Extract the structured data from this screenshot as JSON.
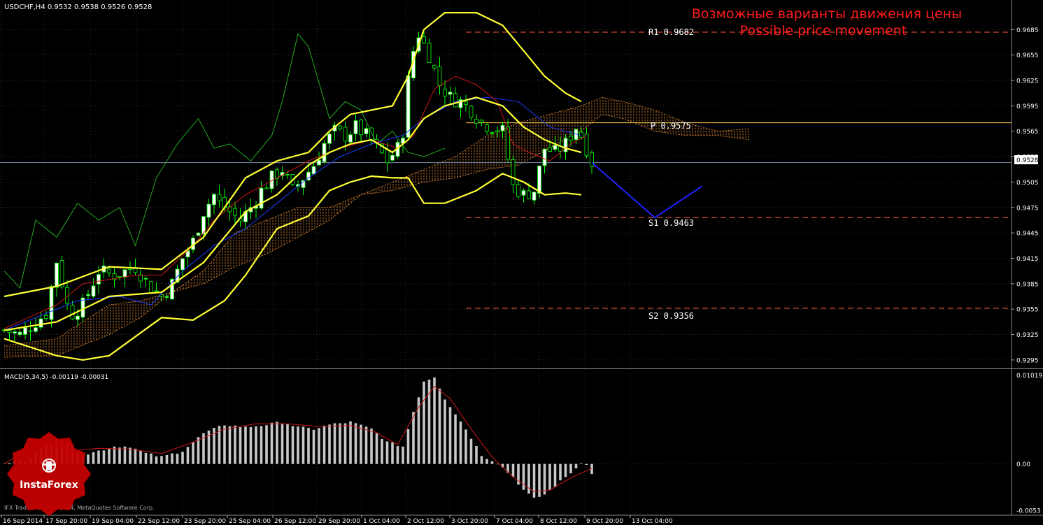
{
  "header": {
    "symbol_info": "USDCHF,H4  0.9532 0.9538 0.9526 0.9528"
  },
  "annotation": {
    "title_ru": "Возможные варианты движения цены",
    "title_en": "Possible price movement"
  },
  "levels": {
    "R1": {
      "label": "R1  0.9682",
      "value": 0.9682
    },
    "P": {
      "label": "P  0.9575",
      "value": 0.9575
    },
    "S1": {
      "label": "S1  0.9463",
      "value": 0.9463
    },
    "S2": {
      "label": "S2  0.9356",
      "value": 0.9356
    }
  },
  "current_price": {
    "label": "0.9528",
    "value": 0.9528
  },
  "macd_label": "MACD(5,34,5) -0.00119 -0.00031",
  "copyright": "IFX Trader, © 2001-2014, MetaQuotes Software Corp.",
  "logo_text": "InstaForex",
  "colors": {
    "background": "#000000",
    "grid": "#4a4a4a",
    "bull_candle": "#ffffff",
    "bear_candle": "#000000",
    "candle_wick": "#00ff00",
    "bollinger": "#ffff33",
    "tenkan": "#cc1818",
    "kijun": "#1a3cff",
    "chikou": "#22aa22",
    "kumo": "#ff9a3a",
    "pivot": "#ffd24a",
    "support_resistance": "#ff5a3a",
    "projection": "#2222ff",
    "macd_hist": "#c8c8c8",
    "macd_signal": "#cc1818",
    "annotation": "#ff1a1a",
    "logo": "#c40000"
  },
  "chart_data": [
    {
      "type": "candlestick",
      "title": "USDCHF,H4",
      "y_ticks": [
        "0.9685",
        "0.9655",
        "0.9625",
        "0.9595",
        "0.9565",
        "0.9535",
        "0.9505",
        "0.9475",
        "0.9445",
        "0.9415",
        "0.9385",
        "0.9355",
        "0.9325",
        "0.9295"
      ],
      "ylim": [
        0.9285,
        0.9715
      ],
      "x_ticks": [
        "16 Sep 2014",
        "17 Sep 20:00",
        "19 Sep 04:00",
        "22 Sep 12:00",
        "23 Sep 20:00",
        "25 Sep 04:00",
        "26 Sep 12:00",
        "29 Sep 20:00",
        "1 Oct 04:00",
        "2 Oct 12:00",
        "3 Oct 20:00",
        "7 Oct 04:00",
        "8 Oct 12:00",
        "9 Oct 20:00",
        "13 Oct 04:00"
      ],
      "bars_total": 171,
      "candles_range": [
        0,
        112
      ],
      "candle_path_close": [
        [
          0,
          0.933
        ],
        [
          3,
          0.9325
        ],
        [
          6,
          0.934
        ],
        [
          8,
          0.935
        ],
        [
          10,
          0.9412
        ],
        [
          12,
          0.936
        ],
        [
          13,
          0.935
        ],
        [
          15,
          0.936
        ],
        [
          18,
          0.94
        ],
        [
          21,
          0.9395
        ],
        [
          23,
          0.94
        ],
        [
          25,
          0.9405
        ],
        [
          28,
          0.938
        ],
        [
          30,
          0.937
        ],
        [
          32,
          0.9385
        ],
        [
          34,
          0.9415
        ],
        [
          36,
          0.9435
        ],
        [
          38,
          0.947
        ],
        [
          40,
          0.949
        ],
        [
          41,
          0.948
        ],
        [
          43,
          0.947
        ],
        [
          45,
          0.946
        ],
        [
          47,
          0.9475
        ],
        [
          49,
          0.9495
        ],
        [
          51,
          0.951
        ],
        [
          53,
          0.952
        ],
        [
          55,
          0.9495
        ],
        [
          57,
          0.951
        ],
        [
          59,
          0.9525
        ],
        [
          61,
          0.955
        ],
        [
          63,
          0.9565
        ],
        [
          65,
          0.956
        ],
        [
          67,
          0.957
        ],
        [
          69,
          0.956
        ],
        [
          71,
          0.9545
        ],
        [
          73,
          0.953
        ],
        [
          75,
          0.9545
        ],
        [
          76,
          0.9565
        ],
        [
          77,
          0.9625
        ],
        [
          78,
          0.966
        ],
        [
          79,
          0.968
        ],
        [
          81,
          0.9655
        ],
        [
          83,
          0.962
        ],
        [
          85,
          0.9605
        ],
        [
          87,
          0.96
        ],
        [
          89,
          0.959
        ],
        [
          91,
          0.9575
        ],
        [
          93,
          0.957
        ],
        [
          95,
          0.9565
        ],
        [
          97,
          0.95
        ],
        [
          99,
          0.949
        ],
        [
          101,
          0.9495
        ],
        [
          103,
          0.9545
        ],
        [
          105,
          0.954
        ],
        [
          107,
          0.955
        ],
        [
          109,
          0.957
        ],
        [
          110,
          0.956
        ],
        [
          111,
          0.9545
        ],
        [
          112,
          0.9528
        ]
      ],
      "bollinger_upper": [
        [
          0,
          0.937
        ],
        [
          10,
          0.9382
        ],
        [
          20,
          0.9405
        ],
        [
          30,
          0.9402
        ],
        [
          38,
          0.944
        ],
        [
          46,
          0.951
        ],
        [
          52,
          0.953
        ],
        [
          58,
          0.954
        ],
        [
          62,
          0.9565
        ],
        [
          66,
          0.9585
        ],
        [
          70,
          0.959
        ],
        [
          74,
          0.9595
        ],
        [
          77,
          0.963
        ],
        [
          80,
          0.9685
        ],
        [
          84,
          0.9705
        ],
        [
          90,
          0.9705
        ],
        [
          95,
          0.969
        ],
        [
          99,
          0.966
        ],
        [
          103,
          0.963
        ],
        [
          107,
          0.961
        ],
        [
          110,
          0.96
        ]
      ],
      "bollinger_middle": [
        [
          0,
          0.933
        ],
        [
          10,
          0.934
        ],
        [
          20,
          0.937
        ],
        [
          30,
          0.9375
        ],
        [
          38,
          0.941
        ],
        [
          46,
          0.947
        ],
        [
          52,
          0.949
        ],
        [
          58,
          0.9525
        ],
        [
          62,
          0.954
        ],
        [
          66,
          0.955
        ],
        [
          70,
          0.9555
        ],
        [
          74,
          0.954
        ],
        [
          77,
          0.9555
        ],
        [
          80,
          0.958
        ],
        [
          84,
          0.9595
        ],
        [
          90,
          0.9605
        ],
        [
          95,
          0.9595
        ],
        [
          99,
          0.957
        ],
        [
          103,
          0.9555
        ],
        [
          107,
          0.9545
        ],
        [
          110,
          0.954
        ]
      ],
      "bollinger_lower": [
        [
          0,
          0.932
        ],
        [
          10,
          0.93
        ],
        [
          15,
          0.9295
        ],
        [
          20,
          0.93
        ],
        [
          30,
          0.9345
        ],
        [
          36,
          0.9342
        ],
        [
          42,
          0.9365
        ],
        [
          46,
          0.9395
        ],
        [
          52,
          0.945
        ],
        [
          58,
          0.9465
        ],
        [
          62,
          0.9495
        ],
        [
          66,
          0.9505
        ],
        [
          70,
          0.9512
        ],
        [
          74,
          0.951
        ],
        [
          77,
          0.951
        ],
        [
          80,
          0.948
        ],
        [
          84,
          0.948
        ],
        [
          90,
          0.9495
        ],
        [
          95,
          0.9515
        ],
        [
          99,
          0.9505
        ],
        [
          103,
          0.949
        ],
        [
          107,
          0.9492
        ],
        [
          110,
          0.949
        ]
      ],
      "tenkan_sen": [
        [
          0,
          0.9332
        ],
        [
          10,
          0.936
        ],
        [
          15,
          0.9385
        ],
        [
          20,
          0.939
        ],
        [
          25,
          0.9395
        ],
        [
          30,
          0.9395
        ],
        [
          36,
          0.943
        ],
        [
          40,
          0.946
        ],
        [
          46,
          0.949
        ],
        [
          52,
          0.951
        ],
        [
          58,
          0.953
        ],
        [
          64,
          0.9545
        ],
        [
          70,
          0.9555
        ],
        [
          75,
          0.9545
        ],
        [
          78,
          0.956
        ],
        [
          82,
          0.9615
        ],
        [
          86,
          0.963
        ],
        [
          90,
          0.962
        ],
        [
          94,
          0.96
        ],
        [
          97,
          0.955
        ],
        [
          100,
          0.954
        ],
        [
          104,
          0.953
        ],
        [
          108,
          0.955
        ],
        [
          111,
          0.956
        ]
      ],
      "kijun_sen": [
        [
          0,
          0.933
        ],
        [
          14,
          0.9365
        ],
        [
          22,
          0.937
        ],
        [
          28,
          0.936
        ],
        [
          34,
          0.94
        ],
        [
          40,
          0.943
        ],
        [
          46,
          0.945
        ],
        [
          52,
          0.948
        ],
        [
          58,
          0.951
        ],
        [
          64,
          0.9535
        ],
        [
          70,
          0.955
        ],
        [
          76,
          0.956
        ],
        [
          80,
          0.958
        ],
        [
          86,
          0.96
        ],
        [
          92,
          0.9605
        ],
        [
          98,
          0.96
        ],
        [
          104,
          0.957
        ],
        [
          110,
          0.956
        ]
      ],
      "chikou_span": [
        [
          0,
          0.94
        ],
        [
          3,
          0.938
        ],
        [
          6,
          0.946
        ],
        [
          10,
          0.944
        ],
        [
          14,
          0.948
        ],
        [
          18,
          0.946
        ],
        [
          22,
          0.9475
        ],
        [
          25,
          0.943
        ],
        [
          29,
          0.951
        ],
        [
          33,
          0.955
        ],
        [
          37,
          0.958
        ],
        [
          40,
          0.9545
        ],
        [
          43,
          0.955
        ],
        [
          47,
          0.953
        ],
        [
          51,
          0.956
        ],
        [
          53,
          0.96
        ],
        [
          56,
          0.968
        ],
        [
          58,
          0.9665
        ],
        [
          62,
          0.958
        ],
        [
          65,
          0.96
        ],
        [
          68,
          0.959
        ],
        [
          71,
          0.955
        ],
        [
          74,
          0.9565
        ],
        [
          77,
          0.954
        ],
        [
          80,
          0.9535
        ],
        [
          84,
          0.9545
        ]
      ],
      "kumo_span_a": [
        [
          0,
          0.9312
        ],
        [
          10,
          0.932
        ],
        [
          20,
          0.936
        ],
        [
          26,
          0.9365
        ],
        [
          32,
          0.9375
        ],
        [
          38,
          0.9385
        ],
        [
          44,
          0.9405
        ],
        [
          50,
          0.942
        ],
        [
          56,
          0.944
        ],
        [
          62,
          0.946
        ],
        [
          68,
          0.949
        ],
        [
          74,
          0.9505
        ],
        [
          80,
          0.952
        ],
        [
          86,
          0.9535
        ],
        [
          92,
          0.956
        ],
        [
          98,
          0.9575
        ],
        [
          104,
          0.9585
        ],
        [
          110,
          0.9595
        ],
        [
          114,
          0.9605
        ],
        [
          118,
          0.96
        ],
        [
          124,
          0.959
        ],
        [
          130,
          0.9575
        ],
        [
          136,
          0.9565
        ],
        [
          142,
          0.9568
        ]
      ],
      "kumo_span_b": [
        [
          0,
          0.9298
        ],
        [
          10,
          0.93
        ],
        [
          20,
          0.9325
        ],
        [
          26,
          0.9345
        ],
        [
          32,
          0.9375
        ],
        [
          38,
          0.94
        ],
        [
          44,
          0.9445
        ],
        [
          50,
          0.946
        ],
        [
          56,
          0.9475
        ],
        [
          62,
          0.9475
        ],
        [
          68,
          0.949
        ],
        [
          74,
          0.9495
        ],
        [
          80,
          0.9505
        ],
        [
          86,
          0.951
        ],
        [
          92,
          0.952
        ],
        [
          98,
          0.9525
        ],
        [
          104,
          0.9545
        ],
        [
          110,
          0.9565
        ],
        [
          114,
          0.9585
        ],
        [
          118,
          0.958
        ],
        [
          124,
          0.9565
        ],
        [
          130,
          0.956
        ],
        [
          136,
          0.956
        ],
        [
          142,
          0.9555
        ]
      ],
      "projection": [
        [
          112,
          0.9528
        ],
        [
          124,
          0.9463
        ],
        [
          133,
          0.95
        ]
      ]
    },
    {
      "type": "bar",
      "title": "MACD(5,34,5)",
      "y_ticks": [
        "0.01019",
        "0.00",
        "-0.0053"
      ],
      "ylim": [
        -0.0058,
        0.0108
      ],
      "histogram": [
        [
          0,
          0.0
        ],
        [
          4,
          0.0005
        ],
        [
          8,
          0.002
        ],
        [
          10,
          0.003
        ],
        [
          12,
          0.0025
        ],
        [
          15,
          0.001
        ],
        [
          18,
          0.0015
        ],
        [
          21,
          0.002
        ],
        [
          24,
          0.002
        ],
        [
          27,
          0.0012
        ],
        [
          30,
          0.0008
        ],
        [
          34,
          0.0015
        ],
        [
          38,
          0.0035
        ],
        [
          42,
          0.0045
        ],
        [
          46,
          0.0042
        ],
        [
          50,
          0.0045
        ],
        [
          53,
          0.0048
        ],
        [
          56,
          0.0042
        ],
        [
          59,
          0.004
        ],
        [
          62,
          0.0045
        ],
        [
          66,
          0.0048
        ],
        [
          70,
          0.004
        ],
        [
          73,
          0.0025
        ],
        [
          76,
          0.002
        ],
        [
          78,
          0.006
        ],
        [
          80,
          0.0095
        ],
        [
          82,
          0.01
        ],
        [
          84,
          0.0075
        ],
        [
          88,
          0.004
        ],
        [
          91,
          0.001
        ],
        [
          94,
          0.0001
        ],
        [
          97,
          -0.0015
        ],
        [
          99,
          -0.003
        ],
        [
          101,
          -0.004
        ],
        [
          103,
          -0.0035
        ],
        [
          106,
          -0.002
        ],
        [
          109,
          -0.0005
        ],
        [
          110,
          0.0002
        ],
        [
          111,
          0.0
        ],
        [
          112,
          -0.0012
        ]
      ],
      "signal": [
        [
          0,
          0.0
        ],
        [
          5,
          0.0018
        ],
        [
          9,
          0.0022
        ],
        [
          13,
          0.0015
        ],
        [
          18,
          0.0018
        ],
        [
          24,
          0.0017
        ],
        [
          30,
          0.0012
        ],
        [
          36,
          0.0025
        ],
        [
          42,
          0.004
        ],
        [
          48,
          0.0046
        ],
        [
          54,
          0.0046
        ],
        [
          60,
          0.0043
        ],
        [
          66,
          0.0044
        ],
        [
          71,
          0.0036
        ],
        [
          75,
          0.0022
        ],
        [
          79,
          0.0065
        ],
        [
          82,
          0.0089
        ],
        [
          85,
          0.0075
        ],
        [
          89,
          0.004
        ],
        [
          93,
          0.0008
        ],
        [
          97,
          -0.0015
        ],
        [
          101,
          -0.0032
        ],
        [
          104,
          -0.003
        ],
        [
          108,
          -0.0016
        ],
        [
          112,
          -0.0005
        ]
      ]
    }
  ]
}
